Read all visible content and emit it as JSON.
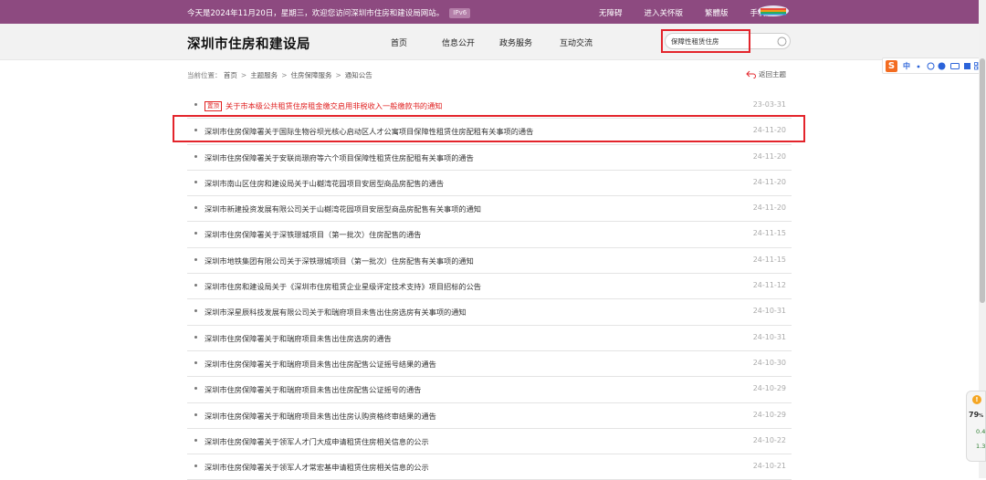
{
  "topbar": {
    "welcome": "今天是2024年11月20日，星期三，欢迎您访问深圳市住房和建设局网站。",
    "ipv6": "IPv6",
    "links": [
      "无障碍",
      "进入关怀版",
      "繁體版",
      "手机版"
    ]
  },
  "header": {
    "site_title": "深圳市住房和建设局",
    "nav": [
      "首页",
      "信息公开",
      "政务服务",
      "互动交流"
    ],
    "search_value": "保障性租赁住房"
  },
  "breadcrumb": {
    "prefix": "当前位置：",
    "items": [
      "首页",
      "主题服务",
      "住房保障服务",
      "通知公告"
    ],
    "separator": ">",
    "back": "返回主题"
  },
  "list": [
    {
      "tag": "置顶",
      "title": "关于市本级公共租赁住房租金缴交启用非税收入一般缴款书的通知",
      "date": "23-03-31",
      "pinned": true
    },
    {
      "title": "深圳市住房保障署关于国际生物谷坝光核心启动区人才公寓项目保障性租赁住房配租有关事项的通告",
      "date": "24-11-20"
    },
    {
      "title": "深圳市住房保障署关于安联尚璟府等六个项目保障性租赁住房配租有关事项的通告",
      "date": "24-11-20"
    },
    {
      "title": "深圳市南山区住房和建设局关于山樾湾花园项目安居型商品房配售的通告",
      "date": "24-11-20"
    },
    {
      "title": "深圳市新建投资发展有限公司关于山樾湾花园项目安居型商品房配售有关事项的通知",
      "date": "24-11-20"
    },
    {
      "title": "深圳市住房保障署关于深铁璟城项目（第一批次）住房配售的通告",
      "date": "24-11-15"
    },
    {
      "title": "深圳市地铁集团有限公司关于深铁璟城项目（第一批次）住房配售有关事项的通知",
      "date": "24-11-15"
    },
    {
      "title": "深圳市住房和建设局关于《深圳市住房租赁企业星级评定技术支持》项目招标的公告",
      "date": "24-11-12"
    },
    {
      "title": "深圳市深星辰科技发展有限公司关于和瑞府项目未售出住房选房有关事项的通知",
      "date": "24-10-31"
    },
    {
      "title": "深圳市住房保障署关于和瑞府项目未售出住房选房的通告",
      "date": "24-10-31"
    },
    {
      "title": "深圳市住房保障署关于和瑞府项目未售出住房配售公证摇号结果的通告",
      "date": "24-10-30"
    },
    {
      "title": "深圳市住房保障署关于和瑞府项目未售出住房配售公证摇号的通告",
      "date": "24-10-29"
    },
    {
      "title": "深圳市住房保障署关于和瑞府项目未售出住房认购资格终审结果的通告",
      "date": "24-10-29"
    },
    {
      "title": "深圳市住房保障署关于领军人才门大成申请租赁住房相关信息的公示",
      "date": "24-10-22"
    },
    {
      "title": "深圳市住房保障署关于领军人才常宏基申请租赁住房相关信息的公示",
      "date": "24-10-21"
    }
  ],
  "ime": {
    "logo": "S",
    "lang": "中"
  },
  "widget": {
    "alert": "!",
    "value": "79",
    "unit": "%",
    "v1": "0.4",
    "v2": "1.3"
  },
  "colors": {
    "topbar": "#8d4a80",
    "highlight": "#e3242b",
    "pinned": "#e02020"
  }
}
